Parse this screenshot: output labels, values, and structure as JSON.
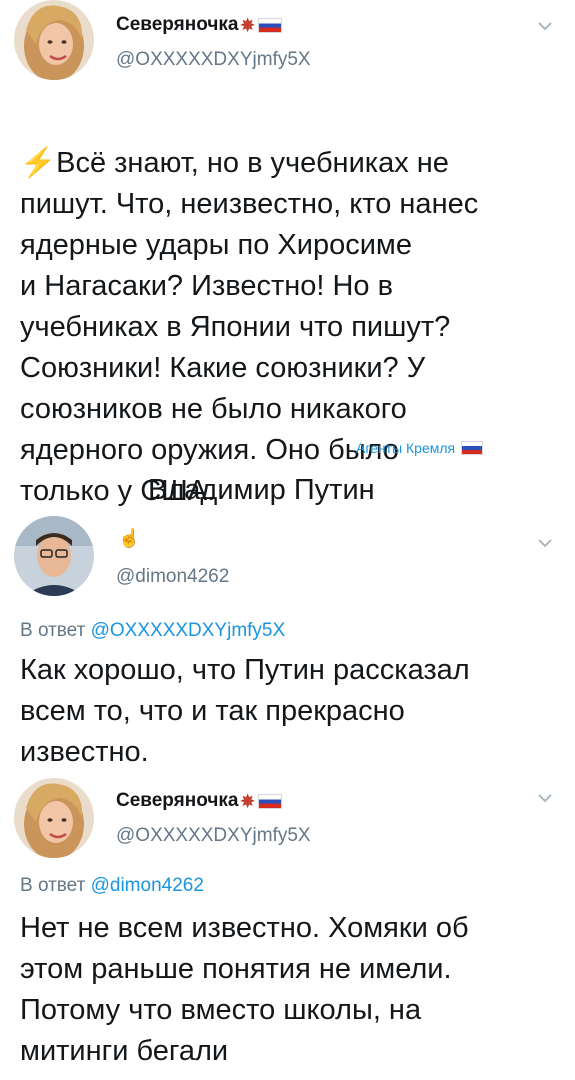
{
  "tweets": [
    {
      "display_name": "Северяночка",
      "handle": "@OXXXXXDXYjmfy5X",
      "emoji_icon": "lightning-icon",
      "text_first": "Всё знают, но в учебниках не",
      "text_rest": "пишут. Что, неизвестно, кто нанес\nядерные удары по Хиросиме\nи Нагасаки? Известно! Но в\nучебниках в Японии что пишут?\nСоюзники! Какие союзники? У\nсоюзников не было никакого\nядерного оружия. Оно было\nтолько у США.",
      "agents_label": "Агенты Кремля",
      "signature": "Владимир Путин"
    },
    {
      "display_name_icon": "hand-icon",
      "handle": "@dimon4262",
      "reply_prefix": "В ответ",
      "reply_to": "@OXXXXXDXYjmfy5X",
      "text": "Как хорошо, что Путин рассказал\nвсем то, что и так прекрасно\nизвестно."
    },
    {
      "display_name": "Северяночка",
      "handle": "@OXXXXXDXYjmfy5X",
      "reply_prefix": "В ответ",
      "reply_to": "@dimon4262",
      "text": "Нет не всем известно. Хомяки об\nэтом раньше понятия не имели.\nПотому что вместо школы, на\nмитинги бегали"
    }
  ],
  "colors": {
    "link": "#1b95e0",
    "secondary": "#657786",
    "text": "#14171a"
  }
}
